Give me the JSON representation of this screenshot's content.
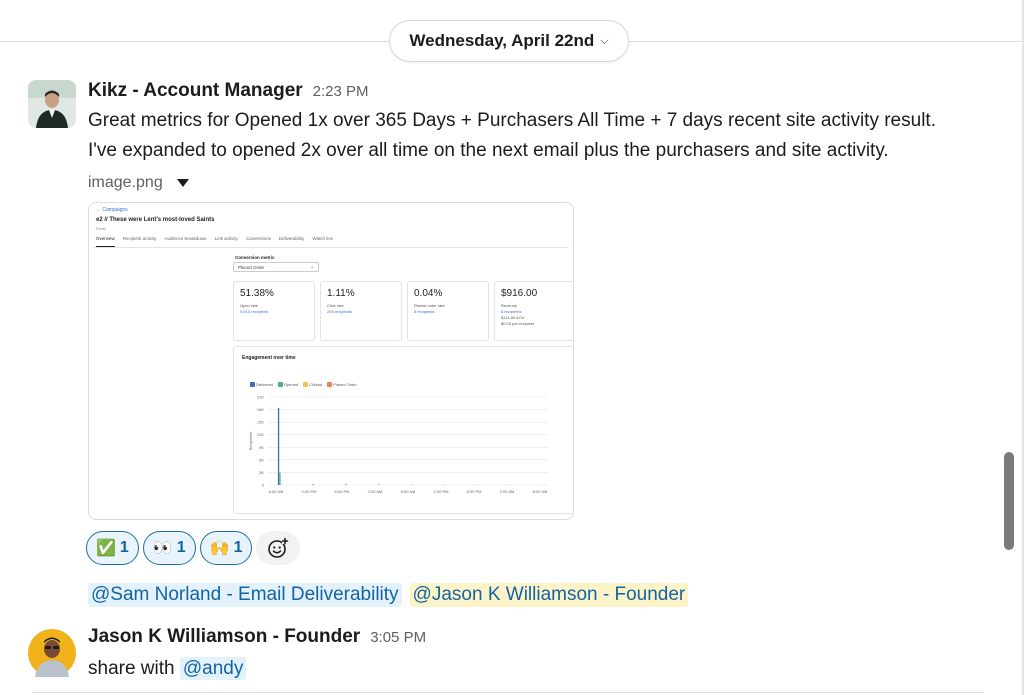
{
  "date_divider": {
    "label": "Wednesday, April 22nd"
  },
  "messages": [
    {
      "sender": "Kikz - Account Manager",
      "time": "2:23 PM",
      "lines": [
        "Great metrics for Opened 1x over 365 Days + Purchasers All Time + 7 days recent site activity result.",
        "I've expanded to opened 2x over all time on the next email plus the purchasers and site activity."
      ],
      "attachment": {
        "file_name": "image.png",
        "screenshot": {
          "breadcrumb": "← Campaigns",
          "campaign_title": "e2 // These were Lent's most-loved Saints",
          "campaign_type": "Email",
          "tabs": [
            "Overview",
            "Recipient activity",
            "Audience breakdown",
            "Link activity",
            "Conversions",
            "Deliverability",
            "Watch live"
          ],
          "conversion_metric_label": "Conversion metric",
          "conversion_metric_value": "Placed Order",
          "cards": [
            {
              "value": "51.38%",
              "label": "Open rate",
              "link": "9,510 recipients",
              "notes": []
            },
            {
              "value": "1.11%",
              "label": "Click rate",
              "link": "206 recipients",
              "notes": []
            },
            {
              "value": "0.04%",
              "label": "Placed order rate",
              "link": "8 recipients",
              "notes": []
            },
            {
              "value": "$916.00",
              "label": "Revenue",
              "link": "8 recipients",
              "notes": [
                "$114.50 AOV",
                "$0.05 per recipient"
              ]
            }
          ],
          "engagement_title": "Engagement over time",
          "legend": [
            {
              "name": "Delivered",
              "color": "#3d6fb0"
            },
            {
              "name": "Opened",
              "color": "#4caf85"
            },
            {
              "name": "Clicked",
              "color": "#f2c14e"
            },
            {
              "name": "Placed Order",
              "color": "#e8825a"
            }
          ],
          "y_axis_label": "Recipients",
          "y_ticks": [
            "21K",
            "18K",
            "15K",
            "12K",
            "9K",
            "6K",
            "3K",
            "0"
          ],
          "x_ticks": [
            "6:00 AM",
            "2:00 PM",
            "8:00 PM",
            "2:00 AM",
            "8:00 AM",
            "2:00 PM",
            "8:00 PM",
            "2:00 AM",
            "8:00 AM"
          ]
        }
      },
      "reactions": [
        {
          "emoji": "✅",
          "count": "1",
          "emoji_name": "check-mark-icon"
        },
        {
          "emoji": "👀",
          "count": "1",
          "emoji_name": "eyes-icon"
        },
        {
          "emoji": "🙌",
          "count": "1",
          "emoji_name": "raised-hands-icon"
        }
      ],
      "mentions": [
        "@Sam Norland - Email Deliverability",
        "@Jason K Williamson - Founder"
      ]
    },
    {
      "sender": "Jason K Williamson - Founder",
      "time": "3:05 PM",
      "text": "share with",
      "mention": "@andy"
    }
  ],
  "chart_data": {
    "type": "line",
    "title": "Engagement over time",
    "ylabel": "Recipients",
    "x": [
      "6:00 AM",
      "2:00 PM",
      "8:00 PM",
      "2:00 AM",
      "8:00 AM",
      "2:00 PM",
      "8:00 PM",
      "2:00 AM",
      "8:00 AM"
    ],
    "ylim": [
      0,
      21000
    ],
    "series": [
      {
        "name": "Delivered",
        "values": [
          18400,
          0,
          0,
          0,
          0,
          0,
          0,
          0,
          0
        ]
      },
      {
        "name": "Opened",
        "values": [
          3000,
          250,
          200,
          150,
          120,
          100,
          80,
          60,
          40
        ]
      },
      {
        "name": "Clicked",
        "values": [
          100,
          10,
          5,
          5,
          5,
          0,
          0,
          0,
          0
        ]
      },
      {
        "name": "Placed Order",
        "values": [
          2,
          1,
          1,
          0,
          0,
          0,
          0,
          0,
          0
        ]
      }
    ]
  }
}
